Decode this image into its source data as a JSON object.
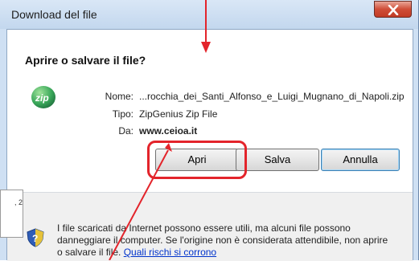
{
  "window": {
    "title": "Download del file"
  },
  "dialog": {
    "heading": "Aprire o salvare il file?",
    "file": {
      "name_label": "Nome:",
      "name_value": "...rocchia_dei_Santi_Alfonso_e_Luigi_Mugnano_di_Napoli.zip",
      "type_label": "Tipo:",
      "type_value": "ZipGenius Zip File",
      "from_label": "Da:",
      "from_value": "www.ceioa.it"
    },
    "buttons": {
      "open": "Apri",
      "save": "Salva",
      "cancel": "Annulla"
    },
    "warning": {
      "text": "I file scaricati da Internet possono essere utili, ma alcuni file possono danneggiare il computer. Se l'origine non è considerata attendibile, non aprire o salvare il file.",
      "link": "Quali rischi si corrono"
    }
  },
  "background_window": {
    "text": ", 2"
  },
  "icons": {
    "file": "zip-icon",
    "security": "shield-icon",
    "close": "close-icon"
  },
  "colors": {
    "annotation_red": "#e3242b",
    "link_blue": "#0033cc",
    "titlebar": "#c8dbf0",
    "close_red": "#c8432d"
  }
}
